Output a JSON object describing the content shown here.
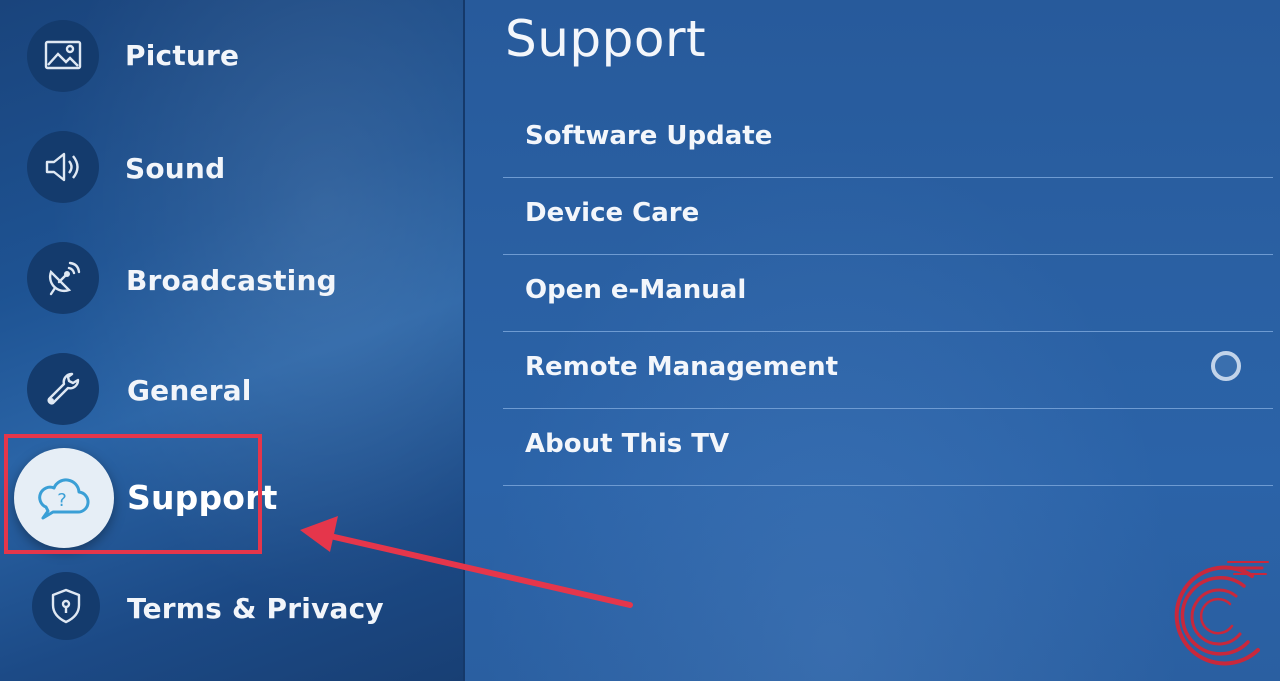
{
  "sidebar": {
    "items": [
      {
        "label": "Picture",
        "icon": "picture-icon"
      },
      {
        "label": "Sound",
        "icon": "speaker-icon"
      },
      {
        "label": "Broadcasting",
        "icon": "satellite-dish-icon"
      },
      {
        "label": "General",
        "icon": "wrench-icon"
      },
      {
        "label": "Support",
        "icon": "cloud-question-icon",
        "selected": true
      },
      {
        "label": "Terms & Privacy",
        "icon": "shield-lock-icon"
      }
    ]
  },
  "panel": {
    "title": "Support",
    "items": [
      {
        "label": "Software Update"
      },
      {
        "label": "Device Care"
      },
      {
        "label": "Open e-Manual"
      },
      {
        "label": "Remote Management",
        "toggle": "off"
      },
      {
        "label": "About This TV"
      }
    ]
  },
  "annotation": {
    "highlight_color": "#e5364b",
    "arrow_color": "#e5364b"
  },
  "colors": {
    "sidebar_bg": "#1e5393",
    "panel_bg": "#2a60a3",
    "selected_circle": "#e6eef6",
    "logo": "#c8283c"
  }
}
